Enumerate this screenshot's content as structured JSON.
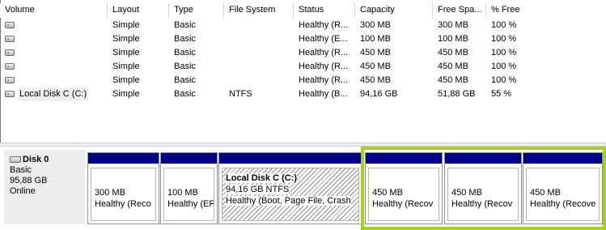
{
  "columns": [
    "Volume",
    "Layout",
    "Type",
    "File System",
    "Status",
    "Capacity",
    "Free Spa...",
    "% Free"
  ],
  "volumes": [
    {
      "name": "",
      "layout": "Simple",
      "type": "Basic",
      "fs": "",
      "status": "Healthy (R...",
      "capacity": "300 MB",
      "free": "300 MB",
      "pct": "100 %"
    },
    {
      "name": "",
      "layout": "Simple",
      "type": "Basic",
      "fs": "",
      "status": "Healthy (E...",
      "capacity": "100 MB",
      "free": "100 MB",
      "pct": "100 %"
    },
    {
      "name": "",
      "layout": "Simple",
      "type": "Basic",
      "fs": "",
      "status": "Healthy (R...",
      "capacity": "450 MB",
      "free": "450 MB",
      "pct": "100 %"
    },
    {
      "name": "",
      "layout": "Simple",
      "type": "Basic",
      "fs": "",
      "status": "Healthy (R...",
      "capacity": "450 MB",
      "free": "450 MB",
      "pct": "100 %"
    },
    {
      "name": "",
      "layout": "Simple",
      "type": "Basic",
      "fs": "",
      "status": "Healthy (R...",
      "capacity": "450 MB",
      "free": "450 MB",
      "pct": "100 %"
    },
    {
      "name": "Local Disk C (C:)",
      "layout": "Simple",
      "type": "Basic",
      "fs": "NTFS",
      "status": "Healthy (B...",
      "capacity": "94,16 GB",
      "free": "51,88 GB",
      "pct": "55 %"
    }
  ],
  "disk": {
    "title": "Disk 0",
    "type": "Basic",
    "size": "95,88 GB",
    "state": "Online"
  },
  "partitions": [
    {
      "name": "",
      "line1": "300 MB",
      "line2": "Healthy (Reco"
    },
    {
      "name": "",
      "line1": "100 MB",
      "line2": "Healthy (EF"
    },
    {
      "name": "Local Disk C  (C:)",
      "line1": "94,16 GB NTFS",
      "line2": "Healthy (Boot, Page File, Crash"
    },
    {
      "name": "",
      "line1": "450 MB",
      "line2": "Healthy (Recov"
    },
    {
      "name": "",
      "line1": "450 MB",
      "line2": "Healthy (Recov"
    },
    {
      "name": "",
      "line1": "450 MB",
      "line2": "Healthy (Recove"
    }
  ],
  "colors": {
    "partition_bar": "#00008b",
    "highlight_border": "#a3d11c",
    "disk_label_bg": "#ececec"
  },
  "icons": {
    "volume": "drive-icon",
    "disk": "disk-drive-icon"
  }
}
